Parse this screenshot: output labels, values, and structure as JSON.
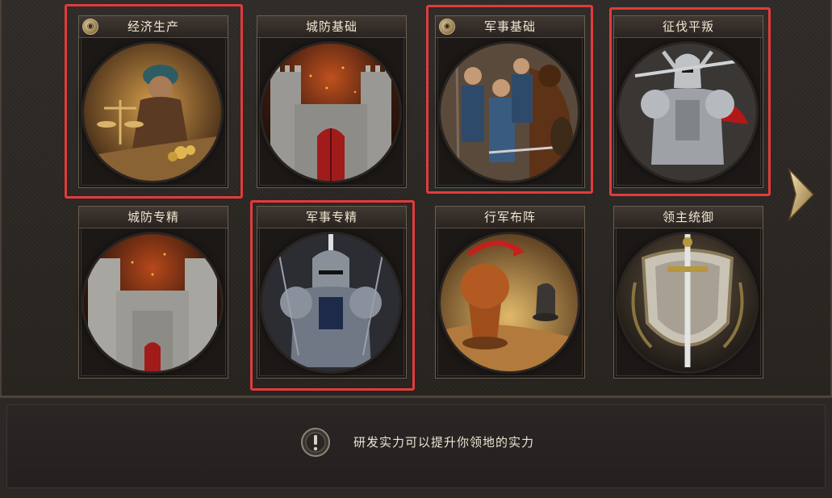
{
  "cards": [
    {
      "id": "economy",
      "title": "经济生产",
      "badge": true,
      "art": "merchant-scales-art"
    },
    {
      "id": "city-defense-basic",
      "title": "城防基础",
      "badge": false,
      "art": "castle-gate-art"
    },
    {
      "id": "military-basic",
      "title": "军事基础",
      "badge": true,
      "art": "soldiers-horse-art"
    },
    {
      "id": "conquest",
      "title": "征伐平叛",
      "badge": false,
      "art": "armored-knight-art"
    },
    {
      "id": "city-defense-expert",
      "title": "城防专精",
      "badge": false,
      "art": "castle-fire-art"
    },
    {
      "id": "military-expert",
      "title": "军事专精",
      "badge": false,
      "art": "knight-sword-art"
    },
    {
      "id": "march-formation",
      "title": "行军布阵",
      "badge": false,
      "art": "chess-pieces-art"
    },
    {
      "id": "lord-command",
      "title": "领主统御",
      "badge": false,
      "art": "shield-sword-art"
    }
  ],
  "highlighted": [
    "economy",
    "military-basic",
    "conquest",
    "military-expert"
  ],
  "tip_text": "研发实力可以提升你领地的实力",
  "colors": {
    "highlight": "#e23b3b",
    "title_text": "#f0e6d0",
    "tip_text": "#ece4d4"
  },
  "icons": {
    "badge": "coin-badge-icon",
    "next": "chevron-right-icon",
    "info": "exclamation-icon"
  }
}
